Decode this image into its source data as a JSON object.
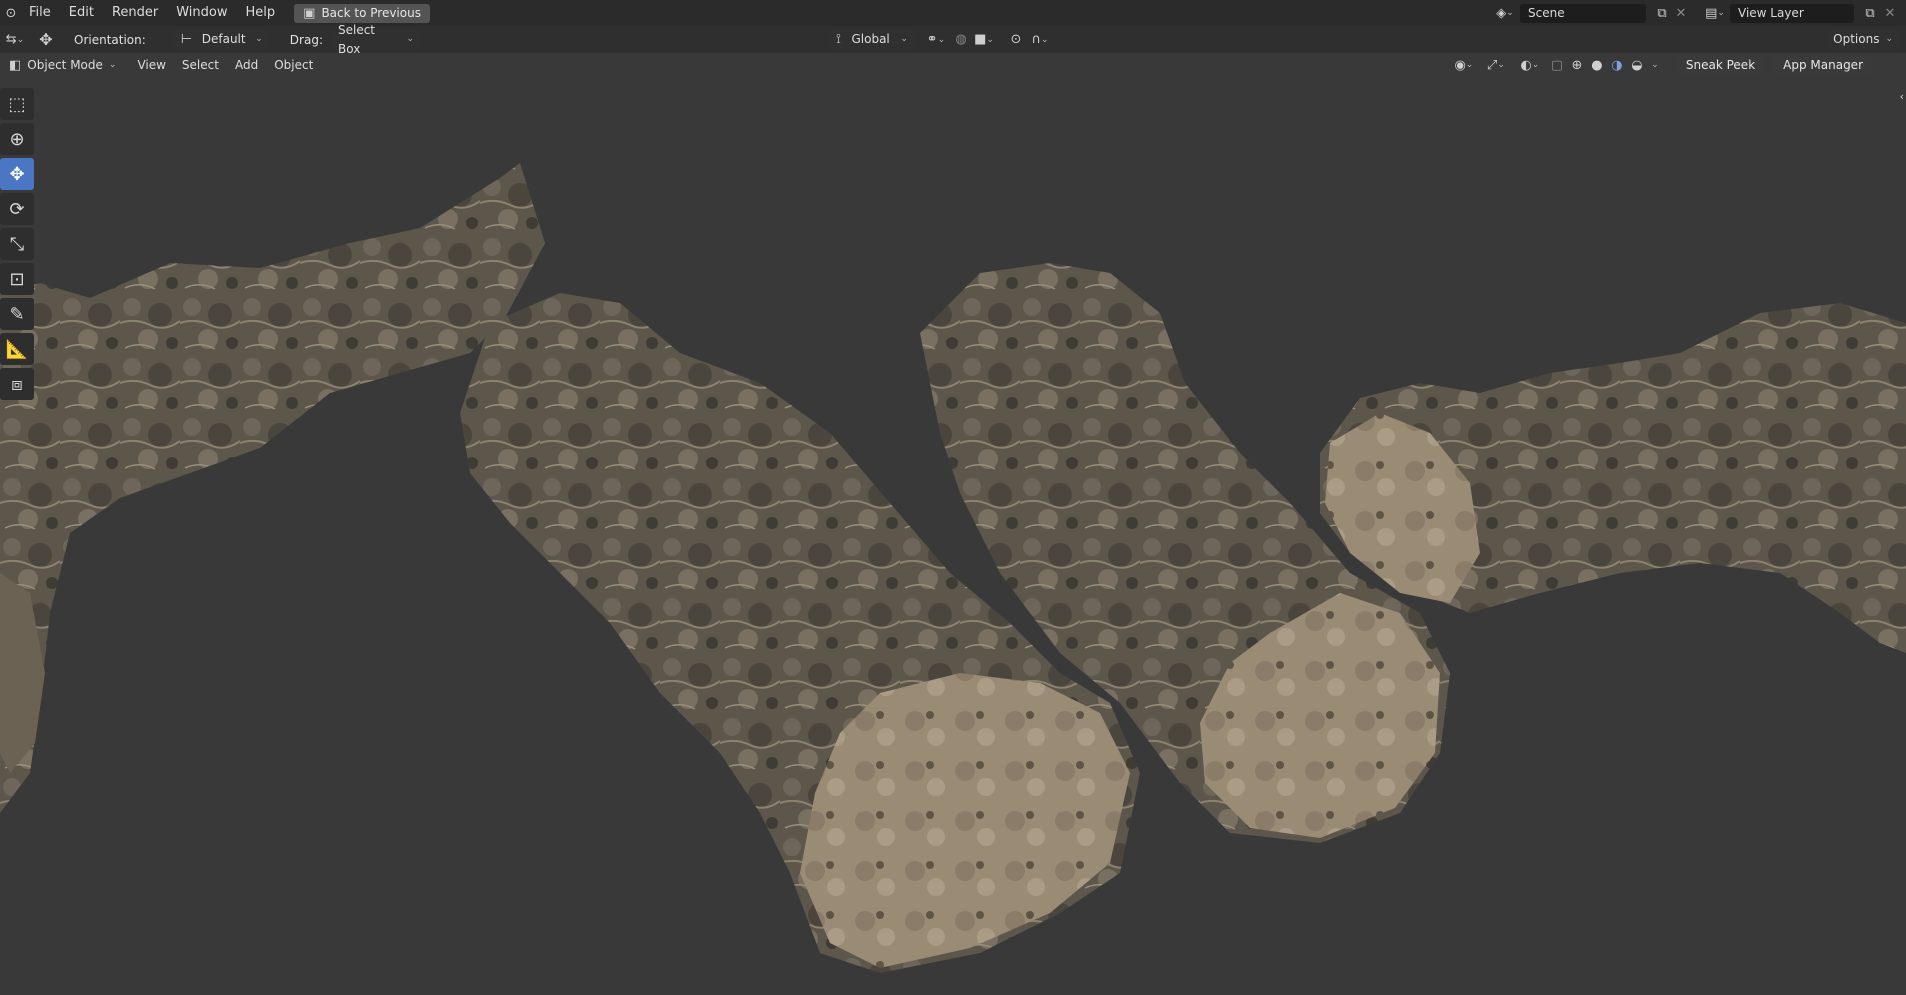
{
  "menubar": {
    "items": [
      "File",
      "Edit",
      "Render",
      "Window",
      "Help"
    ],
    "back_button": "Back to Previous",
    "scene_value": "Scene",
    "view_layer_value": "View Layer"
  },
  "tool_header": {
    "orientation_label": "Orientation:",
    "orientation_value": "Default",
    "drag_label": "Drag:",
    "drag_value": "Select Box",
    "transform_orientation": "Global",
    "options_label": "Options"
  },
  "view_header": {
    "mode": "Object Mode",
    "menus": [
      "View",
      "Select",
      "Add",
      "Object"
    ],
    "sneak_peek": "Sneak Peek",
    "app_manager": "App Manager"
  },
  "toolbar": {
    "tools": [
      "select-box-icon",
      "cursor-icon",
      "move-icon",
      "rotate-icon",
      "scale-icon",
      "transform-icon",
      "annotate-icon",
      "measure-icon",
      "add-cube-icon"
    ],
    "active_tool": "move-icon"
  },
  "colors": {
    "viewport_bg": "#393939",
    "header_bg": "#2b2b2b",
    "accent": "#4a76c3",
    "rock_dark": "#4e4940",
    "rock_light": "#a3947d"
  }
}
